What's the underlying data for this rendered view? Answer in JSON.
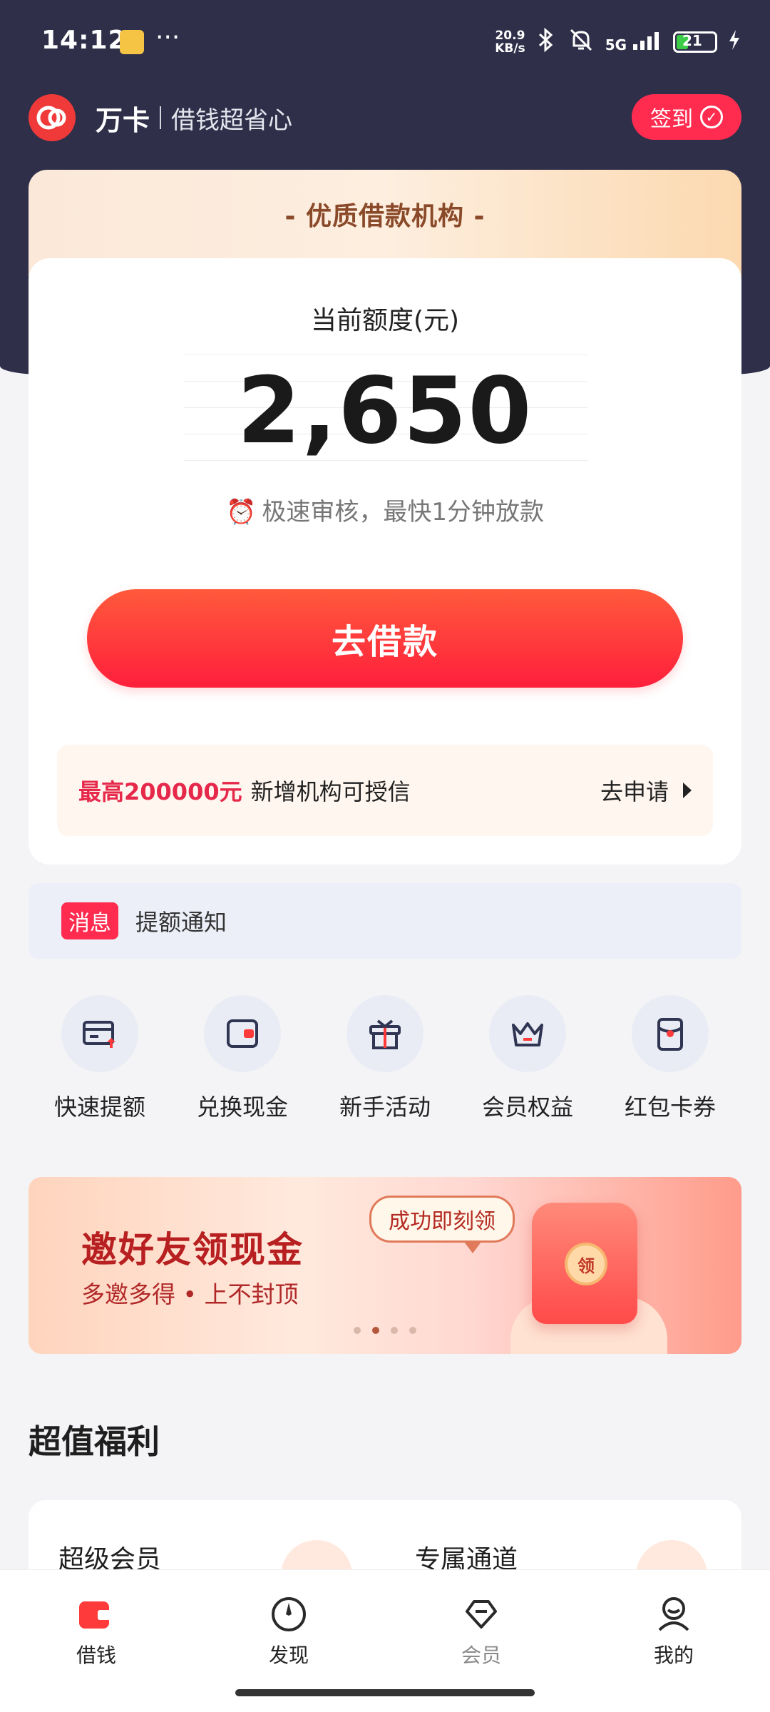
{
  "status_bar": {
    "time": "14:12",
    "dots": "···",
    "net_speed_value": "20.9",
    "net_speed_unit": "KB/s",
    "signal": "5G",
    "battery": "21"
  },
  "header": {
    "app_name": "万卡",
    "slogan": "借钱超省心",
    "signin_label": "签到"
  },
  "card": {
    "banner_title": "- 优质借款机构 -",
    "quota_label": "当前额度(元)",
    "quota_value": "2,650",
    "speed_text": "极速审核，最快1分钟放款",
    "borrow_button": "去借款",
    "apply_highlight": "最高200000元",
    "apply_text": "新增机构可授信",
    "apply_action": "去申请"
  },
  "message": {
    "tag": "消息",
    "text": "提额通知"
  },
  "quick_actions": [
    {
      "label": "快速提额",
      "icon": "card-upload-icon"
    },
    {
      "label": "兑换现金",
      "icon": "wallet-icon"
    },
    {
      "label": "新手活动",
      "icon": "gift-icon"
    },
    {
      "label": "会员权益",
      "icon": "crown-icon"
    },
    {
      "label": "红包卡券",
      "icon": "red-envelope-icon"
    }
  ],
  "promo_banner": {
    "title": "邀好友领现金",
    "subtitle": "多邀多得 • 上不封顶",
    "bubble": "成功即刻领",
    "coin_text": "领",
    "active_dot": 1
  },
  "section": {
    "title": "超值福利",
    "items": [
      "超级会员",
      "专属通道"
    ]
  },
  "bottom_nav": [
    {
      "label": "借钱",
      "icon": "wallet-tab-icon",
      "active": true
    },
    {
      "label": "发现",
      "icon": "compass-icon",
      "active": false
    },
    {
      "label": "会员",
      "icon": "diamond-icon",
      "active": false
    },
    {
      "label": "我的",
      "icon": "profile-icon",
      "active": false
    }
  ],
  "colors": {
    "brand_red": "#ff2c50",
    "header_bg": "#2f2f4a",
    "accent_gold": "#8a4a2a"
  }
}
